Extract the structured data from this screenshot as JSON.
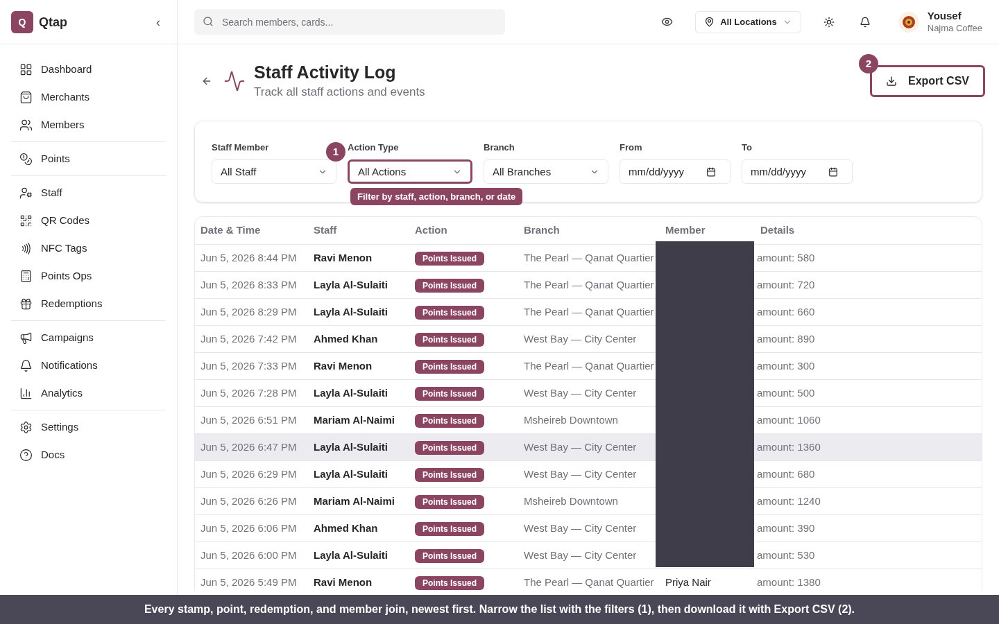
{
  "brand": {
    "logo": "Q",
    "name": "Qtap",
    "collapse": "‹"
  },
  "sidebar": {
    "groups": [
      [
        {
          "label": "Dashboard"
        },
        {
          "label": "Merchants"
        },
        {
          "label": "Members"
        }
      ],
      [
        {
          "label": "Points"
        }
      ],
      [
        {
          "label": "Staff"
        },
        {
          "label": "QR Codes"
        },
        {
          "label": "NFC Tags"
        },
        {
          "label": "Points Ops"
        },
        {
          "label": "Redemptions"
        }
      ],
      [
        {
          "label": "Campaigns"
        },
        {
          "label": "Notifications"
        },
        {
          "label": "Analytics"
        }
      ],
      [
        {
          "label": "Settings"
        },
        {
          "label": "Docs"
        }
      ]
    ]
  },
  "header": {
    "search": {
      "placeholder": "Search members, cards..."
    },
    "location": "All Locations",
    "user": {
      "name": "Yousef",
      "org": "Najma Coffee"
    }
  },
  "page": {
    "title": "Staff Activity Log",
    "subtitle": "Track all staff actions and events",
    "export": {
      "label": "Export CSV",
      "marker": "2"
    }
  },
  "filters": {
    "marker": "1",
    "tooltip": "Filter by staff, action, branch, or date",
    "fields": [
      {
        "kind": "select",
        "label": "Staff Member",
        "value": "All Staff",
        "highlighted": false
      },
      {
        "kind": "select",
        "label": "Action Type",
        "value": "All Actions",
        "highlighted": true
      },
      {
        "kind": "select",
        "label": "Branch",
        "value": "All Branches",
        "highlighted": false
      },
      {
        "kind": "date",
        "label": "From",
        "value": "mm/dd/yyyy",
        "highlighted": false
      },
      {
        "kind": "date",
        "label": "To",
        "value": "mm/dd/yyyy",
        "highlighted": false
      }
    ]
  },
  "table": {
    "columns": [
      "Date & Time",
      "Staff",
      "Action",
      "Branch",
      "Member",
      "Details"
    ],
    "rows": [
      {
        "time": "Jun 5, 2026 8:44 PM",
        "staff": "Ravi Menon",
        "action": "Points Issued",
        "branch": "The Pearl — Qanat Quartier",
        "details": "amount: 580",
        "highlighted": false
      },
      {
        "time": "Jun 5, 2026 8:33 PM",
        "staff": "Layla Al-Sulaiti",
        "action": "Points Issued",
        "branch": "The Pearl — Qanat Quartier",
        "details": "amount: 720",
        "highlighted": false
      },
      {
        "time": "Jun 5, 2026 8:29 PM",
        "staff": "Layla Al-Sulaiti",
        "action": "Points Issued",
        "branch": "The Pearl — Qanat Quartier",
        "details": "amount: 660",
        "highlighted": false
      },
      {
        "time": "Jun 5, 2026 7:42 PM",
        "staff": "Ahmed Khan",
        "action": "Points Issued",
        "branch": "West Bay — City Center",
        "details": "amount: 890",
        "highlighted": false
      },
      {
        "time": "Jun 5, 2026 7:33 PM",
        "staff": "Ravi Menon",
        "action": "Points Issued",
        "branch": "The Pearl — Qanat Quartier",
        "details": "amount: 300",
        "highlighted": false
      },
      {
        "time": "Jun 5, 2026 7:28 PM",
        "staff": "Layla Al-Sulaiti",
        "action": "Points Issued",
        "branch": "West Bay — City Center",
        "details": "amount: 500",
        "highlighted": false
      },
      {
        "time": "Jun 5, 2026 6:51 PM",
        "staff": "Mariam Al-Naimi",
        "action": "Points Issued",
        "branch": "Msheireb Downtown",
        "details": "amount: 1060",
        "highlighted": false
      },
      {
        "time": "Jun 5, 2026 6:47 PM",
        "staff": "Layla Al-Sulaiti",
        "action": "Points Issued",
        "branch": "West Bay — City Center",
        "details": "amount: 1360",
        "highlighted": true
      },
      {
        "time": "Jun 5, 2026 6:29 PM",
        "staff": "Layla Al-Sulaiti",
        "action": "Points Issued",
        "branch": "West Bay — City Center",
        "details": "amount: 680",
        "highlighted": false
      },
      {
        "time": "Jun 5, 2026 6:26 PM",
        "staff": "Mariam Al-Naimi",
        "action": "Points Issued",
        "branch": "Msheireb Downtown",
        "details": "amount: 1240",
        "highlighted": false
      },
      {
        "time": "Jun 5, 2026 6:06 PM",
        "staff": "Ahmed Khan",
        "action": "Points Issued",
        "branch": "West Bay — City Center",
        "details": "amount: 390",
        "highlighted": false
      },
      {
        "time": "Jun 5, 2026 6:00 PM",
        "staff": "Layla Al-Sulaiti",
        "action": "Points Issued",
        "branch": "West Bay — City Center",
        "details": "amount: 530",
        "highlighted": false
      },
      {
        "time": "Jun 5, 2026 5:49 PM",
        "staff": "Ravi Menon",
        "action": "Points Issued",
        "branch": "The Pearl — Qanat Quartier",
        "member": "Priya Nair",
        "details": "amount: 1380",
        "highlighted": false
      }
    ]
  },
  "banner": "Every stamp, point, redemption, and member join, newest first. Narrow the list with the filters (1), then download it with Export CSV (2)."
}
